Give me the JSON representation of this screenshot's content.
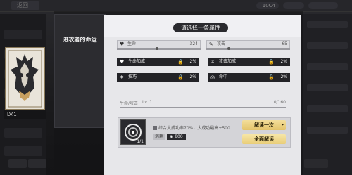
{
  "topbar": {
    "back_label": "返回",
    "resource_1": "",
    "resource_2": "",
    "resource_3": "10C4"
  },
  "fate": {
    "title": "进攻者的命运",
    "level": "LV.1"
  },
  "dialog": {
    "title": "请选择一条属性",
    "stat_bars": [
      {
        "icon": "heart-icon",
        "label": "生命",
        "value": "324"
      },
      {
        "icon": "sword-icon",
        "label": "攻击",
        "value": "65"
      }
    ],
    "attributes": [
      {
        "icon": "heart-icon",
        "label": "生命加成",
        "value": "2%"
      },
      {
        "icon": "sword-icon",
        "label": "攻击加成",
        "value": "2%"
      },
      {
        "icon": "skill-icon",
        "label": "技巧",
        "value": "2%"
      },
      {
        "icon": "target-icon",
        "label": "命中",
        "value": "2%"
      }
    ],
    "level_row": {
      "label": "生命/攻击",
      "level": "Lv. 1",
      "progress": "0/160"
    },
    "item": {
      "qty": "1/1",
      "description": "综合大成功率70%，大成功最高+500",
      "cost_label": "消耗",
      "cost_value": "800"
    },
    "buttons": {
      "decode_one": "解读一次",
      "decode_all": "全面解读"
    }
  },
  "colors": {
    "accent_gold": "#e9cd78",
    "panel_bg": "#e7e7ea",
    "dark": "#232327"
  }
}
